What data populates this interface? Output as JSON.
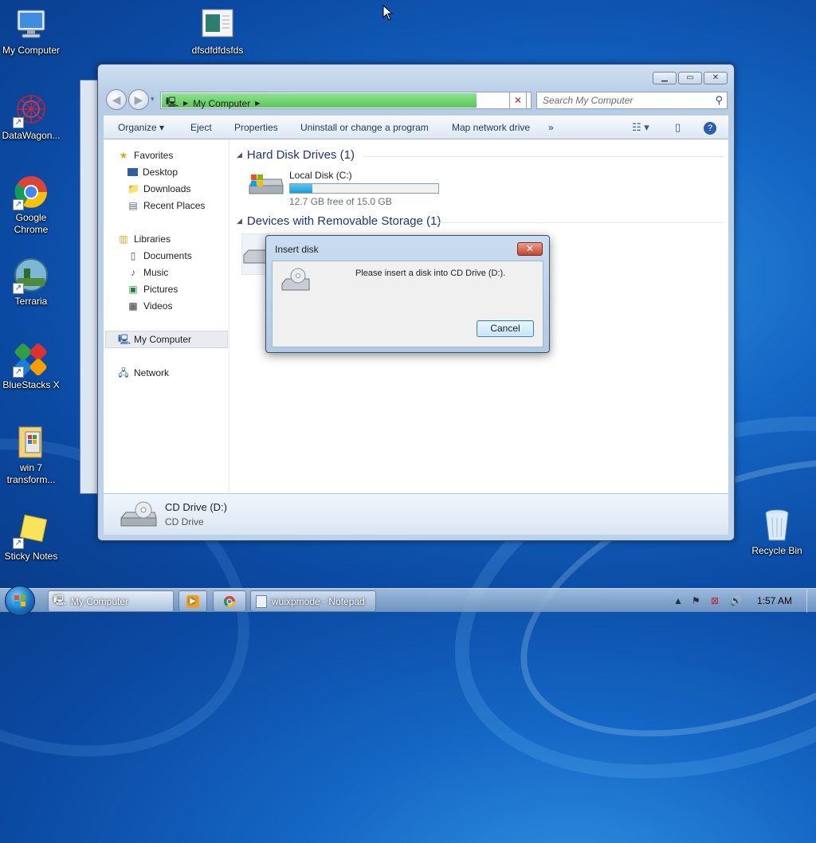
{
  "desktop": {
    "icons": [
      {
        "label": "My Computer"
      },
      {
        "label": "DataWagon..."
      },
      {
        "label": "Google Chrome"
      },
      {
        "label": "Terraria"
      },
      {
        "label": "BlueStacks X"
      },
      {
        "label": "win 7 transform..."
      },
      {
        "label": "Sticky Notes"
      },
      {
        "label": "dfsdfdfdsfds"
      },
      {
        "label": "Recycle Bin"
      }
    ]
  },
  "explorer": {
    "address": {
      "segment": "My Computer"
    },
    "search": {
      "placeholder": "Search My Computer"
    },
    "toolbar": {
      "organize": "Organize",
      "eject": "Eject",
      "properties": "Properties",
      "uninstall": "Uninstall or change a program",
      "map_drive": "Map network drive",
      "more": "»"
    },
    "sidebar": {
      "favorites": "Favorites",
      "desktop": "Desktop",
      "downloads": "Downloads",
      "recent": "Recent Places",
      "libraries": "Libraries",
      "documents": "Documents",
      "music": "Music",
      "pictures": "Pictures",
      "videos": "Videos",
      "my_computer": "My Computer",
      "network": "Network"
    },
    "groups": {
      "hdd": "Hard Disk Drives (1)",
      "removable": "Devices with Removable Storage (1)"
    },
    "local_disk": {
      "name": "Local Disk (C:)",
      "free": "12.7 GB free of 15.0 GB",
      "used_fraction": 0.153
    },
    "details": {
      "name": "CD Drive (D:)",
      "type": "CD Drive"
    }
  },
  "dialog": {
    "title": "Insert disk",
    "message": "Please insert a disk into CD Drive (D:).",
    "cancel": "Cancel"
  },
  "taskbar": {
    "my_computer": "My Computer",
    "notepad": "wuixpmode - Notepad",
    "clock": "1:57 AM"
  }
}
